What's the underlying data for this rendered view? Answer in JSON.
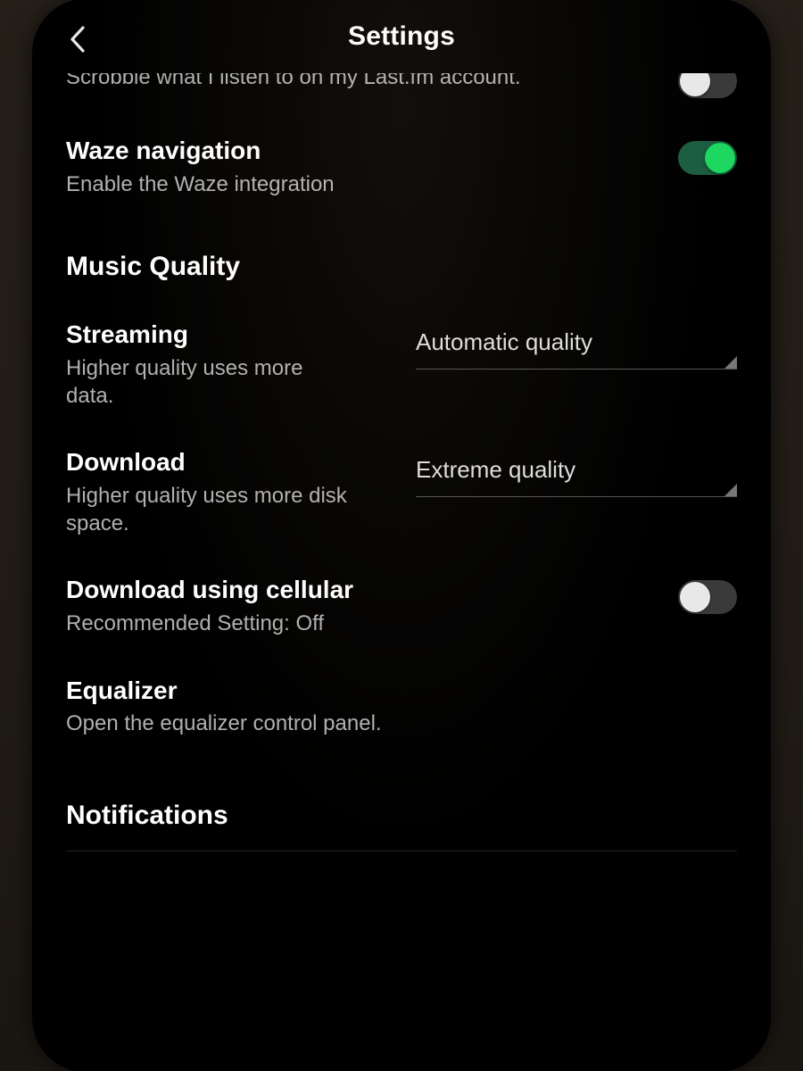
{
  "header": {
    "title": "Settings"
  },
  "rows": {
    "scrobble": {
      "desc": "Scrobble what I listen to on my Last.fm account.",
      "on": false
    },
    "waze": {
      "title": "Waze navigation",
      "desc": "Enable the Waze integration",
      "on": true
    }
  },
  "sections": {
    "music_quality": "Music Quality",
    "notifications": "Notifications"
  },
  "quality": {
    "streaming": {
      "title": "Streaming",
      "desc": "Higher quality uses more data.",
      "value": "Automatic quality"
    },
    "download": {
      "title": "Download",
      "desc": "Higher quality uses more disk space.",
      "value": "Extreme quality"
    },
    "cellular": {
      "title": "Download using cellular",
      "desc": "Recommended Setting: Off",
      "on": false
    },
    "equalizer": {
      "title": "Equalizer",
      "desc": "Open the equalizer control panel."
    }
  }
}
